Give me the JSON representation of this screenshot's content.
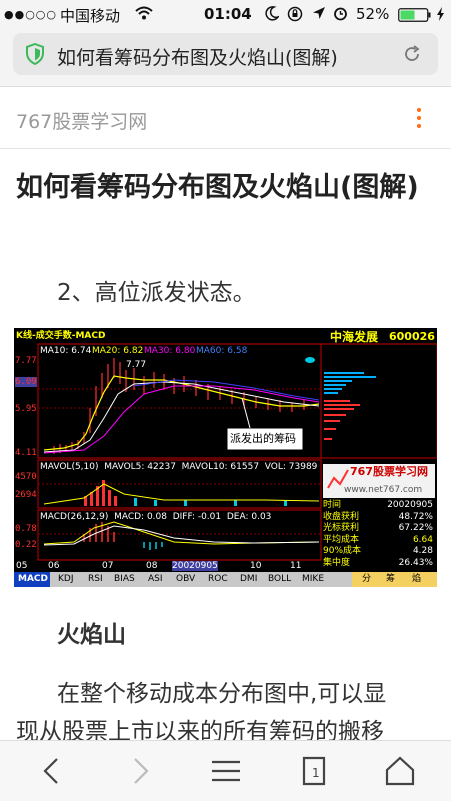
{
  "status_bar": {
    "signal_dots": "●●○○○",
    "carrier": "中国移动",
    "time": "01:04",
    "battery_percent": "52%"
  },
  "url_bar": {
    "title": "如何看筹码分布图及火焰山(图解)"
  },
  "site": {
    "name": "767股票学习网"
  },
  "article": {
    "title": "如何看筹码分布图及火焰山(图解)",
    "section_label": "2、高位派发状态。",
    "subheading": "火焰山",
    "body_line1": "在整个移动成本分布图中,可以显",
    "body_line2": "现从股票上市以来的所有筹码的搬移"
  },
  "chart_image": {
    "header_left": "K线-成交手数-MACD",
    "stock_name": "中海发展",
    "stock_code": "600026",
    "ma_line": {
      "ma10": "MA10: 6.74",
      "ma20": "MA20: 6.82",
      "ma30": "MA30: 6.80",
      "ma60": "MA60: 6.58"
    },
    "price_labels": [
      "7.77",
      "6.09",
      "5.95",
      "4.11"
    ],
    "peak_label": "7.77",
    "annotation": "派发出的筹码",
    "vol_line": "MAVOL(5,10)  MAVOL5: 42237  MAVOL10: 61557  VOL: 73989",
    "vol_labels": [
      "4570",
      "2694"
    ],
    "macd_line": "MACD(26,12,9)  MACD: 0.08  DIFF: -0.01  DEA: 0.03",
    "macd_labels": [
      "0.78",
      "0.22"
    ],
    "x_labels": [
      "05",
      "06",
      "07",
      "08",
      "20020905",
      "10",
      "11"
    ],
    "tabs": [
      "MACD",
      "KDJ",
      "RSI",
      "BIAS",
      "ASI",
      "OBV",
      "ROC",
      "DMI",
      "BOLL",
      "MIKE",
      "分",
      "筹",
      "焰"
    ],
    "watermark_title": "767股票学习网",
    "watermark_url": "www.net767.com",
    "stats": [
      {
        "label": "时间",
        "value": "20020905"
      },
      {
        "label": "收盘获利",
        "value": "48.72%"
      },
      {
        "label": "光标获利",
        "value": "67.22%"
      },
      {
        "label": "平均成本",
        "value": "6.64"
      },
      {
        "label": "90%成本",
        "value": "4.28"
      },
      {
        "label": "集中度",
        "value": "26.43%"
      }
    ]
  },
  "colors": {
    "accent": "#ff6a1a",
    "shield": "#3cb95a",
    "chart_red": "#ff3030",
    "chart_yellow": "#ffff00",
    "chart_cyan": "#00c8e0"
  },
  "icons": {
    "wifi": "wifi-icon",
    "moon": "moon-icon",
    "lock_rotation": "rotation-lock-icon",
    "location": "location-icon",
    "alarm": "alarm-icon",
    "battery": "battery-icon",
    "charging": "charging-icon",
    "shield": "shield-icon",
    "reload": "reload-icon",
    "back": "back-icon",
    "forward": "forward-icon",
    "menu": "menu-icon",
    "tabs": "tabs-icon",
    "home": "home-icon"
  }
}
